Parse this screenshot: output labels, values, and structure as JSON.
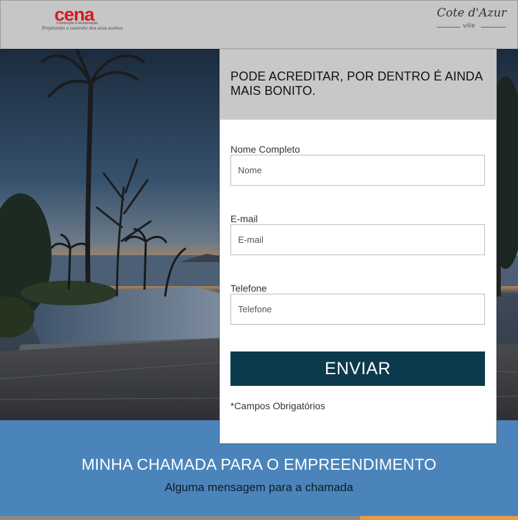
{
  "header": {
    "brand_logo": {
      "name": "cena",
      "subtitle": "Construção e Incorporação",
      "tagline": "Projetando o caminho dos seus sonhos",
      "color": "#d7191f"
    },
    "project_logo": {
      "script": "Cote d'Azur",
      "sub": "ville"
    }
  },
  "form": {
    "heading": "PODE ACREDITAR, POR DENTRO É AINDA MAIS BONITO.",
    "fields": [
      {
        "label": "Nome Completo",
        "placeholder": "Nome",
        "value": ""
      },
      {
        "label": "E-mail",
        "placeholder": "E-mail",
        "value": ""
      },
      {
        "label": "Telefone",
        "placeholder": "Telefone",
        "value": ""
      }
    ],
    "submit_label": "ENVIAR",
    "required_note": "*Campos Obrigatórios",
    "button_color": "#0c3a4d"
  },
  "footer": {
    "title": "MINHA CHAMADA PARA O EMPREENDIMENTO",
    "message": "Alguma mensagem para a chamada",
    "band_color": "#4a84bb"
  }
}
